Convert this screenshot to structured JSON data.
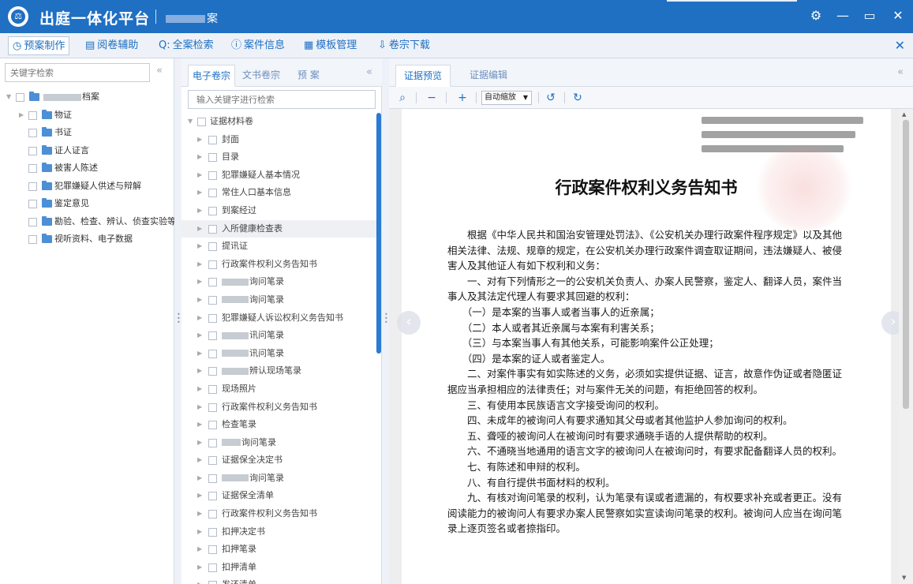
{
  "window": {
    "app_title": "出庭一体化平台",
    "case_suffix": "案",
    "logo_glyph": "⚖",
    "controls": {
      "settings": "⚙",
      "minimize": "—",
      "restore": "▭",
      "close": "✕"
    }
  },
  "toolbar": {
    "items": [
      {
        "icon": "◷",
        "label": "预案制作"
      },
      {
        "icon": "▤",
        "label": "阅卷辅助"
      },
      {
        "icon": "Q:",
        "label": "全案检索"
      },
      {
        "icon": "ⓘ",
        "label": "案件信息"
      },
      {
        "icon": "▦",
        "label": "模板管理"
      },
      {
        "icon": "⇩",
        "label": "卷宗下载"
      }
    ],
    "close_glyph": "✕"
  },
  "left_panel": {
    "search_placeholder": "关键字检索",
    "collapse_glyph": "«",
    "root_label_suffix": "档案",
    "categories": [
      "物证",
      "书证",
      "证人证言",
      "被害人陈述",
      "犯罪嫌疑人供述与辩解",
      "鉴定意见",
      "勘验、检查、辨认、侦查实验等",
      "视听资料、电子数据"
    ]
  },
  "middle_panel": {
    "tabs": [
      "电子卷宗",
      "文书卷宗",
      "预 案"
    ],
    "collapse_glyph": "«",
    "search_placeholder": "输入关键字进行检索",
    "root_label": "证据材料卷",
    "items": [
      "封面",
      "目录",
      "犯罪嫌疑人基本情况",
      "常住人口基本信息",
      "到案经过",
      "入所健康检查表",
      "提讯证",
      "行政案件权利义务告知书",
      "询问笔录",
      "询问笔录",
      "犯罪嫌疑人诉讼权利义务告知书",
      "讯问笔录",
      "讯问笔录",
      "辨认现场笔录",
      "现场照片",
      "行政案件权利义务告知书",
      "检查笔录",
      "询问笔录",
      "证据保全决定书",
      "询问笔录",
      "证据保全清单",
      "行政案件权利义务告知书",
      "扣押决定书",
      "扣押笔录",
      "扣押清单",
      "发还清单"
    ]
  },
  "right_panel": {
    "tabs": [
      "证据预览",
      "证据编辑"
    ],
    "collapse_glyph": "«",
    "viewer": {
      "search_glyph": "⌕",
      "zoom_out": "−",
      "zoom_in": "+",
      "zoom_value": "自动缩放",
      "rotate_ccw": "↺",
      "rotate_cw": "↻",
      "prev_glyph": "‹",
      "next_glyph": "›"
    },
    "document": {
      "title": "行政案件权利义务告知书",
      "paragraphs": [
        "　　根据《中华人民共和国治安管理处罚法》、《公安机关办理行政案件程序规定》以及其他相关法律、法规、规章的规定，在公安机关办理行政案件调查取证期间，违法嫌疑人、被侵害人及其他证人有如下权利和义务：",
        "　　一、对有下列情形之一的公安机关负责人、办案人民警察，鉴定人、翻译人员，案件当事人及其法定代理人有要求其回避的权利：",
        "　　（一）是本案的当事人或者当事人的近亲属；",
        "　　（二）本人或者其近亲属与本案有利害关系；",
        "　　（三）与本案当事人有其他关系，可能影响案件公正处理；",
        "　　（四）是本案的证人或者鉴定人。",
        "　　二、对案件事实有如实陈述的义务，必须如实提供证据、证言，故意作伪证或者隐匿证据应当承担相应的法律责任；对与案件无关的问题，有拒绝回答的权利。",
        "　　三、有使用本民族语言文字接受询问的权利。",
        "　　四、未成年的被询问人有要求通知其父母或者其他监护人参加询问的权利。",
        "　　五、聋哑的被询问人在被询问时有要求通晓手语的人提供帮助的权利。",
        "　　六、不通晓当地通用的语言文字的被询问人在被询问时，有要求配备翻译人员的权利。",
        "　　七、有陈述和申辩的权利。",
        "　　八、有自行提供书面材料的权利。",
        "　　九、有核对询问笔录的权利，认为笔录有误或者遗漏的，有权要求补充或者更正。没有阅读能力的被询问人有要求办案人民警察如实宣读询问笔录的权利。被询问人应当在询问笔录上逐页签名或者捺指印。"
      ]
    }
  },
  "colors": {
    "primary": "#1f6fc2",
    "toolbar_bg": "#eef2f8",
    "scroll_accent": "#2a7bd3"
  }
}
